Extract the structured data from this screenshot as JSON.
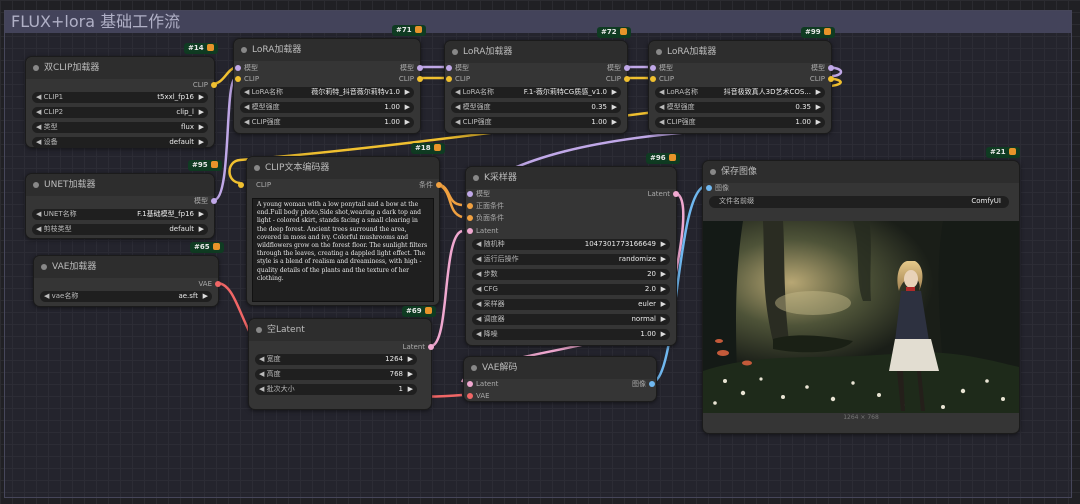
{
  "workflow": {
    "title": "FLUX+lora 基础工作流"
  },
  "colors": {
    "clip": "#f0c030",
    "model": "#c0a8e8",
    "latent": "#f0a8d0",
    "image": "#70b8f0",
    "vae": "#f06666",
    "conditioning": "#f0a040",
    "badge": "#0f3b22"
  },
  "nodes": {
    "dualclip": {
      "badge": "#14",
      "title": "双CLIP加载器",
      "output": "CLIP",
      "widgets": [
        {
          "label": "CLIP1",
          "value": "t5xxl_fp16"
        },
        {
          "label": "CLIP2",
          "value": "clip_l"
        },
        {
          "label": "类型",
          "value": "flux"
        },
        {
          "label": "设备",
          "value": "default"
        }
      ]
    },
    "lora1": {
      "badge": "#71",
      "title": "LoRA加载器",
      "in_model": "模型",
      "in_clip": "CLIP",
      "out_model": "模型",
      "out_clip": "CLIP",
      "widgets": [
        {
          "label": "LoRA名称",
          "value": "薇尔莉特_抖音薇尔莉特v1.0"
        },
        {
          "label": "模型强度",
          "value": "1.00"
        },
        {
          "label": "CLIP强度",
          "value": "1.00"
        }
      ]
    },
    "lora2": {
      "badge": "#72",
      "title": "LoRA加载器",
      "in_model": "模型",
      "in_clip": "CLIP",
      "out_model": "模型",
      "out_clip": "CLIP",
      "widgets": [
        {
          "label": "LoRA名称",
          "value": "F.1-薇尔莉特CG质感_v1.0"
        },
        {
          "label": "模型强度",
          "value": "0.35"
        },
        {
          "label": "CLIP强度",
          "value": "1.00"
        }
      ]
    },
    "lora3": {
      "badge": "#99",
      "title": "LoRA加载器",
      "in_model": "模型",
      "in_clip": "CLIP",
      "out_model": "模型",
      "out_clip": "CLIP",
      "widgets": [
        {
          "label": "LoRA名称",
          "value": "抖音极致真人3D艺术COS..."
        },
        {
          "label": "模型强度",
          "value": "0.35"
        },
        {
          "label": "CLIP强度",
          "value": "1.00"
        }
      ]
    },
    "unet": {
      "badge": "#95",
      "title": "UNET加载器",
      "output": "模型",
      "widgets": [
        {
          "label": "UNET名称",
          "value": "F.1基础模型_fp16"
        },
        {
          "label": "剪枝类型",
          "value": "default"
        }
      ]
    },
    "clipenc": {
      "badge": "#18",
      "title": "CLIP文本编码器",
      "input": "CLIP",
      "output": "条件",
      "text": "A young woman with a low ponytail and a bow at the end.Full body photo,Side shot,wearing a dark top and light - colored skirt, stands facing a small clearing in the deep forest. Ancient trees surround the area, covered in moss and ivy. Colorful mushrooms and wildflowers grow on the forest floor. The sunlight filters through the leaves, creating a dappled light effect. The style is a blend of realism and dreaminess, with high - quality details of the plants and the texture of her clothing."
    },
    "vaeload": {
      "badge": "#65",
      "title": "VAE加载器",
      "output": "VAE",
      "widgets": [
        {
          "label": "vae名称",
          "value": "ae.sft"
        }
      ]
    },
    "ksampler": {
      "badge": "#96",
      "title": "K采样器",
      "inputs": [
        "模型",
        "正面条件",
        "负面条件",
        "Latent"
      ],
      "output": "Latent",
      "widgets": [
        {
          "label": "随机种",
          "value": "1047301773166649"
        },
        {
          "label": "运行后操作",
          "value": "randomize"
        },
        {
          "label": "步数",
          "value": "20"
        },
        {
          "label": "CFG",
          "value": "2.0"
        },
        {
          "label": "采样器",
          "value": "euler"
        },
        {
          "label": "调度器",
          "value": "normal"
        },
        {
          "label": "降噪",
          "value": "1.00"
        }
      ]
    },
    "emptylatent": {
      "badge": "#69",
      "title": "空Latent",
      "output": "Latent",
      "widgets": [
        {
          "label": "宽度",
          "value": "1264"
        },
        {
          "label": "高度",
          "value": "768"
        },
        {
          "label": "批次大小",
          "value": "1"
        }
      ]
    },
    "vaedecode": {
      "title": "VAE解码",
      "inputs": [
        "Latent",
        "VAE"
      ],
      "output": "图像"
    },
    "save": {
      "badge": "#21",
      "title": "保存图像",
      "input": "图像",
      "widgets": [
        {
          "label": "文件名前缀",
          "value": "ComfyUI"
        }
      ],
      "image_size": "1264 × 768"
    }
  }
}
